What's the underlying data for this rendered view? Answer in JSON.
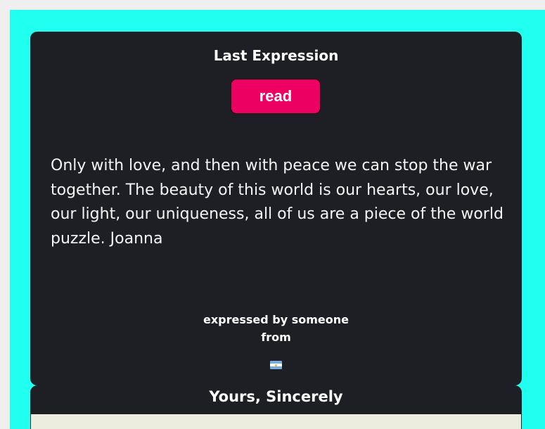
{
  "last_expression": {
    "title": "Last Expression",
    "read_button_label": "read",
    "message": "Only with love, and then with peace we can stop the war together. The beauty of this world is our hearts, our love, our light, our uniqueness, all of us are a piece of the world puzzle. Joanna",
    "expressed_by": "expressed by someone",
    "from_label": "from",
    "flag_icon": "argentina-flag-icon"
  },
  "sincerely_section": {
    "title": "Yours, Sincerely"
  },
  "colors": {
    "page_background": "#21fff0",
    "card_background": "#1e1f24",
    "button_accent": "#ec0061",
    "text": "#ffffff",
    "inner_panel": "#ededdf"
  }
}
